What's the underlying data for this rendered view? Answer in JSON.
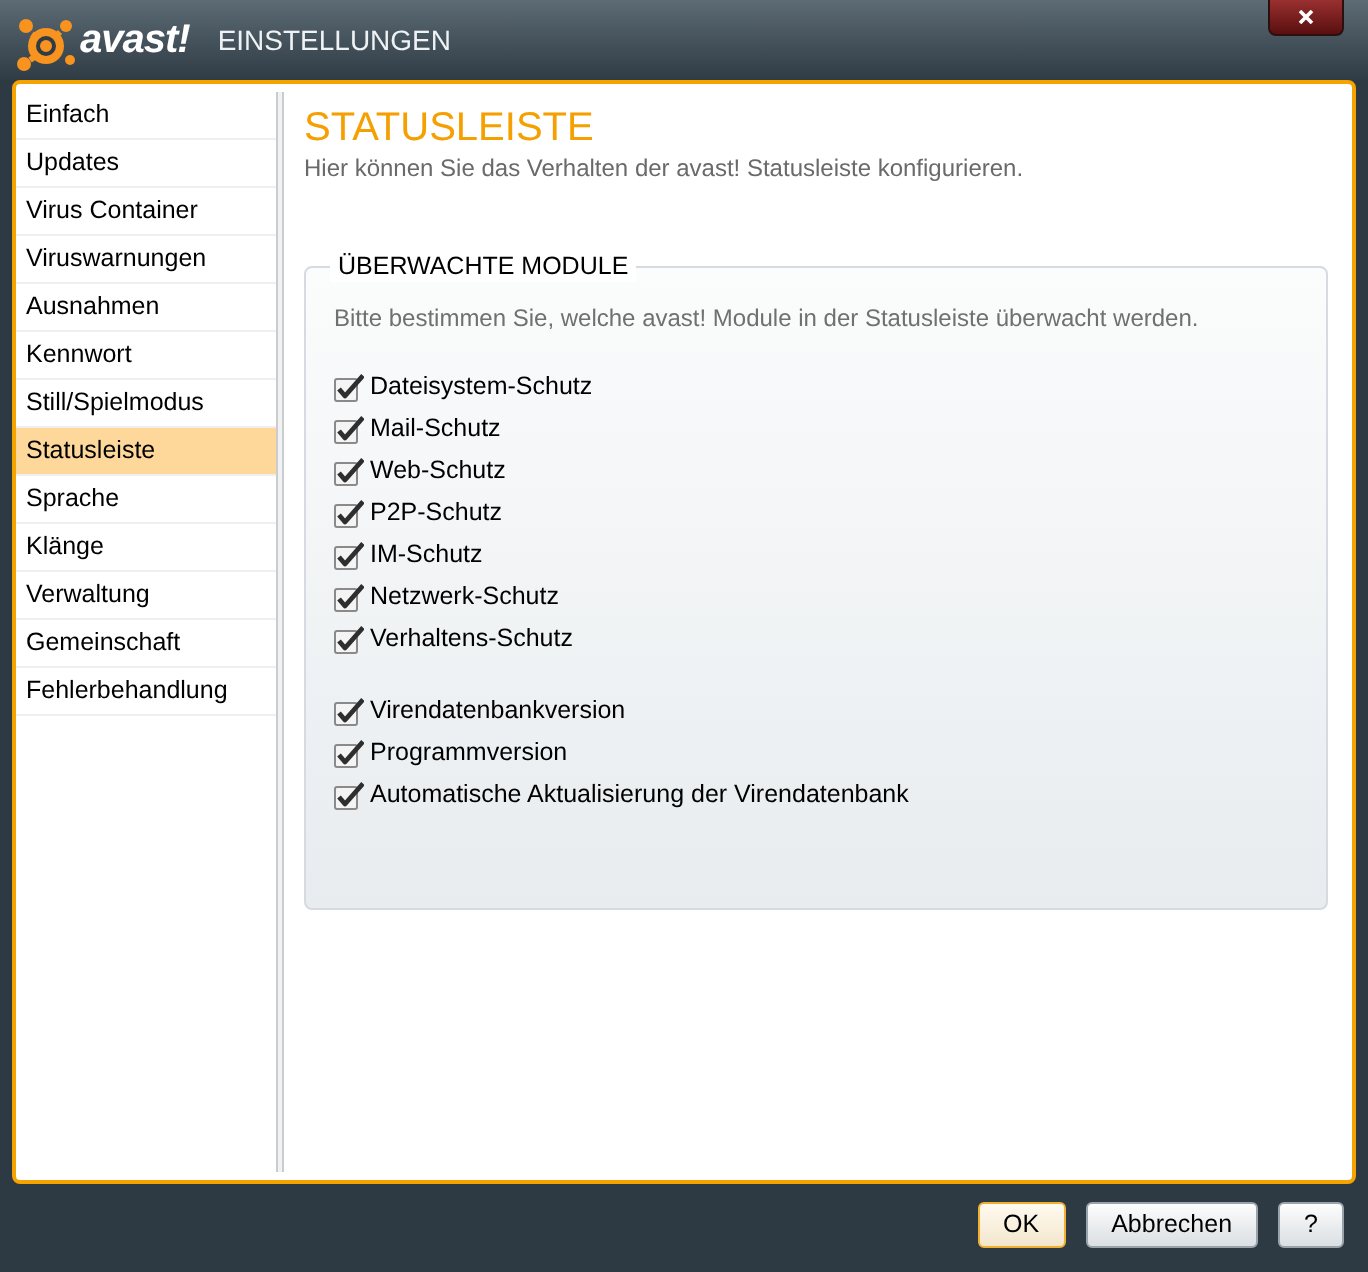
{
  "window": {
    "logo_text": "avast!",
    "title": "EINSTELLUNGEN"
  },
  "sidebar": {
    "items": [
      {
        "label": "Einfach",
        "selected": false
      },
      {
        "label": "Updates",
        "selected": false
      },
      {
        "label": "Virus Container",
        "selected": false
      },
      {
        "label": "Viruswarnungen",
        "selected": false
      },
      {
        "label": "Ausnahmen",
        "selected": false
      },
      {
        "label": "Kennwort",
        "selected": false
      },
      {
        "label": "Still/Spielmodus",
        "selected": false
      },
      {
        "label": "Statusleiste",
        "selected": true
      },
      {
        "label": "Sprache",
        "selected": false
      },
      {
        "label": "Klänge",
        "selected": false
      },
      {
        "label": "Verwaltung",
        "selected": false
      },
      {
        "label": "Gemeinschaft",
        "selected": false
      },
      {
        "label": "Fehlerbehandlung",
        "selected": false
      }
    ]
  },
  "content": {
    "title": "STATUSLEISTE",
    "subtitle": "Hier können Sie das Verhalten der avast! Statusleiste konfigurieren.",
    "group": {
      "legend": "ÜBERWACHTE MODULE",
      "description": "Bitte bestimmen Sie, welche avast! Module in der Statusleiste überwacht werden.",
      "checkbox_groups": [
        [
          {
            "label": "Dateisystem-Schutz",
            "checked": true
          },
          {
            "label": "Mail-Schutz",
            "checked": true
          },
          {
            "label": "Web-Schutz",
            "checked": true
          },
          {
            "label": "P2P-Schutz",
            "checked": true
          },
          {
            "label": "IM-Schutz",
            "checked": true
          },
          {
            "label": "Netzwerk-Schutz",
            "checked": true
          },
          {
            "label": "Verhaltens-Schutz",
            "checked": true
          }
        ],
        [
          {
            "label": "Virendatenbankversion",
            "checked": true
          },
          {
            "label": "Programmversion",
            "checked": true
          },
          {
            "label": "Automatische Aktualisierung der Virendatenbank",
            "checked": true
          }
        ]
      ]
    }
  },
  "buttons": [
    {
      "label": "OK",
      "default": true
    },
    {
      "label": "Abbrechen",
      "default": false
    },
    {
      "label": "?",
      "default": false
    }
  ]
}
